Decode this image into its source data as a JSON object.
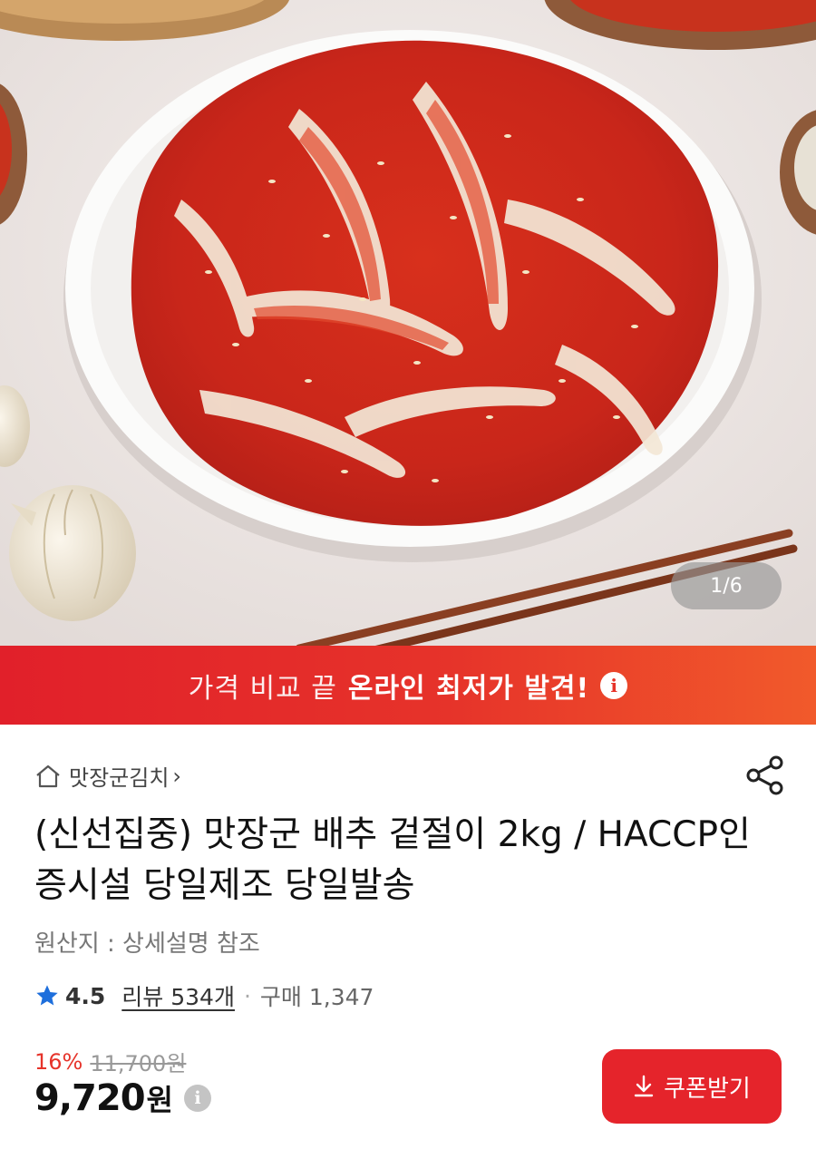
{
  "hero": {
    "image_alt": "kimchi-plate-photo",
    "counter": "1/6"
  },
  "banner": {
    "lead": "가격 비교 끝",
    "strong": "온라인 최저가 발견!",
    "info_icon": "i"
  },
  "store": {
    "name": "맛장군김치",
    "chevron": "›",
    "home_icon": "home-icon",
    "share_icon": "share-icon"
  },
  "product": {
    "title": "(신선집중) 맛장군 배추 겉절이 2kg / HACCP인증시설 당일제조 당일발송",
    "origin": "원산지 : 상세설명 참조"
  },
  "rating": {
    "score": "4.5",
    "reviews": "리뷰 534개",
    "separator": "·",
    "purchases": "구매 1,347",
    "star_color": "#1e6fdc"
  },
  "price": {
    "discount": "16%",
    "original": "11,700원",
    "current": "9,720",
    "currency": "원",
    "info_icon": "i"
  },
  "coupon": {
    "label": "쿠폰받기",
    "icon": "download-icon"
  },
  "colors": {
    "accent": "#e6332a",
    "banner_end": "#f15a2b"
  }
}
